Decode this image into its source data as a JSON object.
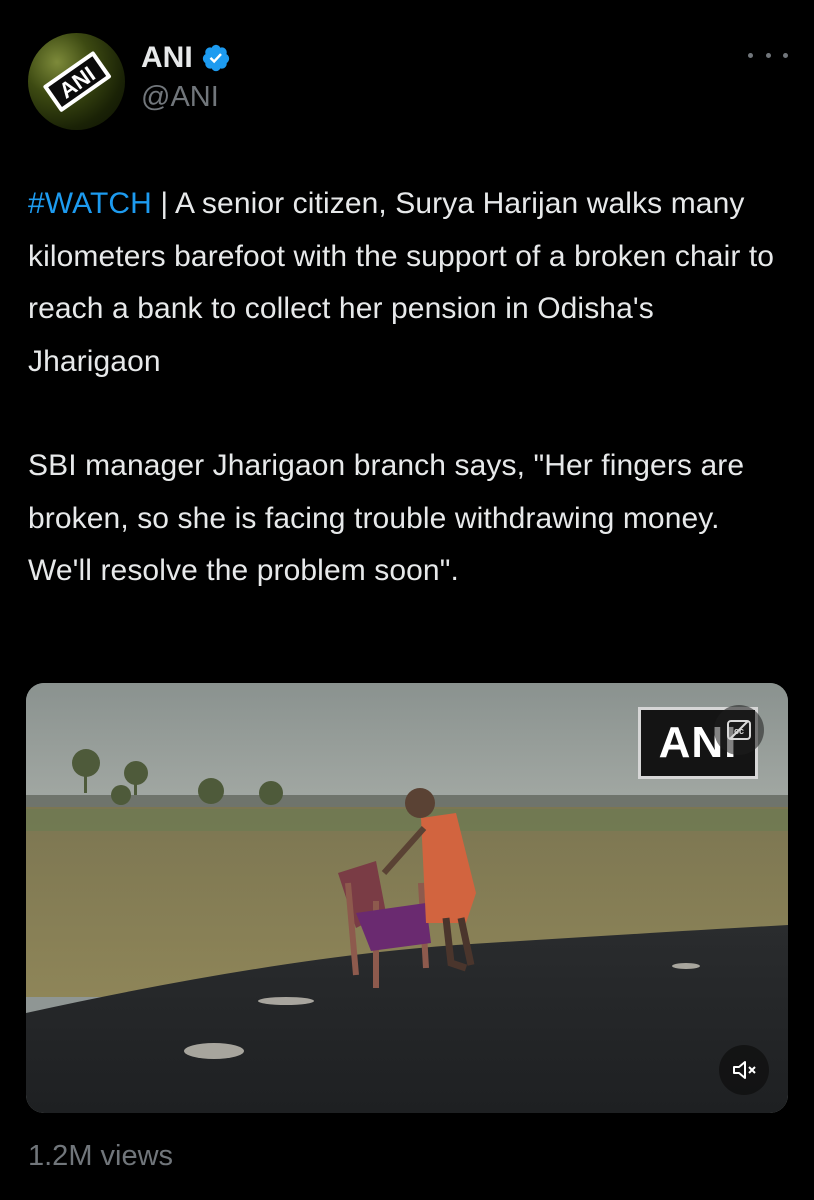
{
  "author": {
    "name": "ANI",
    "handle": "@ANI",
    "avatar_text": "ANI",
    "verified": true
  },
  "tweet": {
    "hashtag": "#WATCH",
    "separator": " | ",
    "line1_rest": "A senior citizen, Surya Harijan walks many kilometers barefoot with the support of a broken chair to reach a bank to collect her pension in Odisha's Jharigaon",
    "paragraph2": "SBI manager Jharigaon branch says, \"Her fingers are broken, so she is facing trouble withdrawing money. We'll resolve the problem soon\"."
  },
  "media": {
    "type": "video",
    "watermark": "ANI"
  },
  "stats": {
    "views": "1.2M views"
  },
  "icons": {
    "more": "more-options-icon",
    "verified": "verified-badge-icon",
    "captions": "captions-icon",
    "mute": "muted-speaker-icon"
  },
  "colors": {
    "background": "#000000",
    "text": "#e7e9ea",
    "secondary": "#71767b",
    "accent": "#1d9bf0"
  }
}
